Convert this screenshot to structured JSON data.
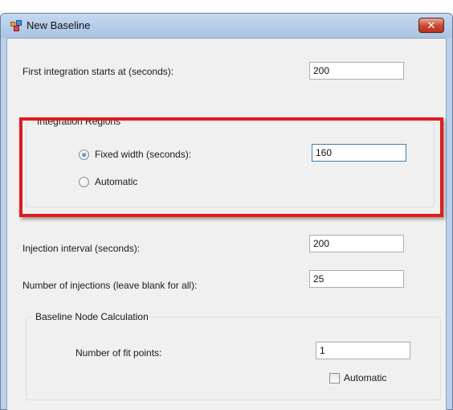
{
  "window": {
    "title": "New Baseline",
    "close_glyph": "✕"
  },
  "fields": {
    "first_integration_label": "First integration starts at (seconds):",
    "first_integration_value": "200",
    "injection_interval_label": "Injection interval (seconds):",
    "injection_interval_value": "200",
    "num_injections_label": "Number of injections (leave blank for all):",
    "num_injections_value": "25"
  },
  "integration_regions": {
    "title": "Integration Regions",
    "fixed_width_label": "Fixed width (seconds):",
    "fixed_width_value": "160",
    "automatic_label": "Automatic",
    "selected": "fixed_width"
  },
  "baseline_node": {
    "title": "Baseline Node Calculation",
    "fit_points_label": "Number of fit points:",
    "fit_points_value": "1",
    "automatic_label": "Automatic",
    "automatic_checked": false
  },
  "colors": {
    "highlight_border": "#e01b1b",
    "title_bar": "#b9d1ea",
    "close_button": "#c7452f"
  }
}
